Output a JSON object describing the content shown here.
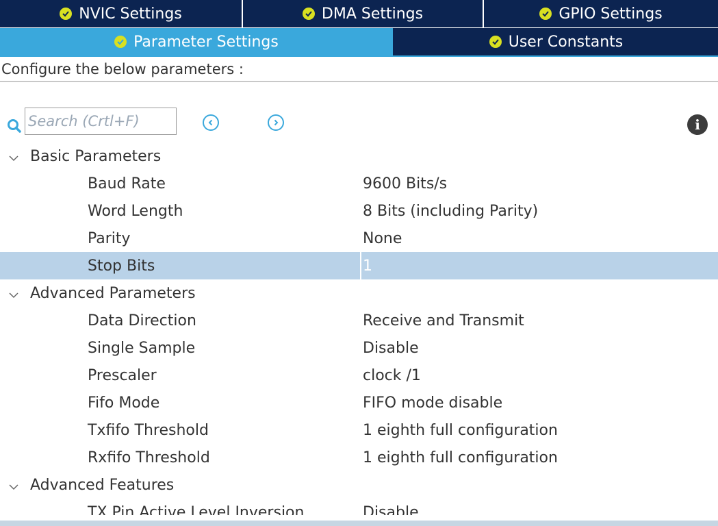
{
  "tabs_row1": [
    {
      "label": "NVIC Settings"
    },
    {
      "label": "DMA Settings"
    },
    {
      "label": "GPIO Settings"
    }
  ],
  "tabs_row2": [
    {
      "label": "Parameter Settings",
      "active": true
    },
    {
      "label": "User Constants",
      "active": false
    }
  ],
  "configure_label": "Configure the below parameters :",
  "search": {
    "placeholder": "Search (Crtl+F)"
  },
  "icons": {
    "search": "search-icon",
    "prev": "chevron-left-circle-icon",
    "next": "chevron-right-circle-icon",
    "info": "info-icon",
    "tab_check": "check-circle-icon",
    "group_toggle": "chevron-down-icon"
  },
  "colors": {
    "tab_dark": "#0c2451",
    "tab_active": "#3aa8dc",
    "check": "#d9e021",
    "selected_row": "#b9d2e8"
  },
  "groups": [
    {
      "label": "Basic Parameters",
      "params": [
        {
          "name": "Baud Rate",
          "value": "9600 Bits/s"
        },
        {
          "name": "Word Length",
          "value": "8 Bits (including Parity)"
        },
        {
          "name": "Parity",
          "value": "None"
        },
        {
          "name": "Stop Bits",
          "value": "1",
          "selected": true
        }
      ]
    },
    {
      "label": "Advanced Parameters",
      "params": [
        {
          "name": "Data Direction",
          "value": "Receive and Transmit"
        },
        {
          "name": "Single Sample",
          "value": "Disable"
        },
        {
          "name": "Prescaler",
          "value": "clock /1"
        },
        {
          "name": "Fifo Mode",
          "value": "FIFO mode disable"
        },
        {
          "name": "Txfifo Threshold",
          "value": "1 eighth full configuration"
        },
        {
          "name": "Rxfifo Threshold",
          "value": "1 eighth full configuration"
        }
      ]
    },
    {
      "label": "Advanced Features",
      "params": [
        {
          "name": "TX Pin Active Level Inversion",
          "value": "Disable"
        }
      ]
    }
  ]
}
